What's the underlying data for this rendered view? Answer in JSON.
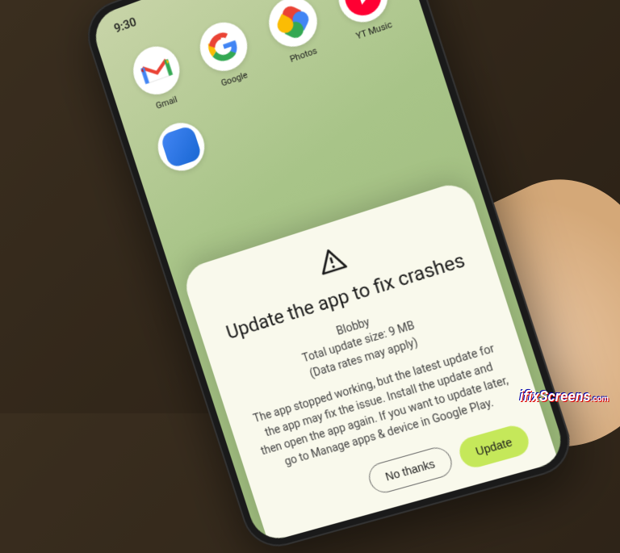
{
  "status": {
    "time": "9:30"
  },
  "apps": {
    "gmail": "Gmail",
    "google": "Google",
    "photos": "Photos",
    "ytmusic": "YT Music"
  },
  "dialog": {
    "title": "Update the app to fix crashes",
    "app_name": "Blobby",
    "size_line": "Total update size: 9 MB",
    "rates_line": "(Data rates may apply)",
    "body": "The app stopped working, but the latest update for the app may fix the issue. Install the update and then open the app again. If you want to update later, go to Manage apps & device in Google Play.",
    "no_thanks": "No thanks",
    "update": "Update"
  },
  "watermark": {
    "text": "ifixScreens",
    "suffix": ".com"
  }
}
